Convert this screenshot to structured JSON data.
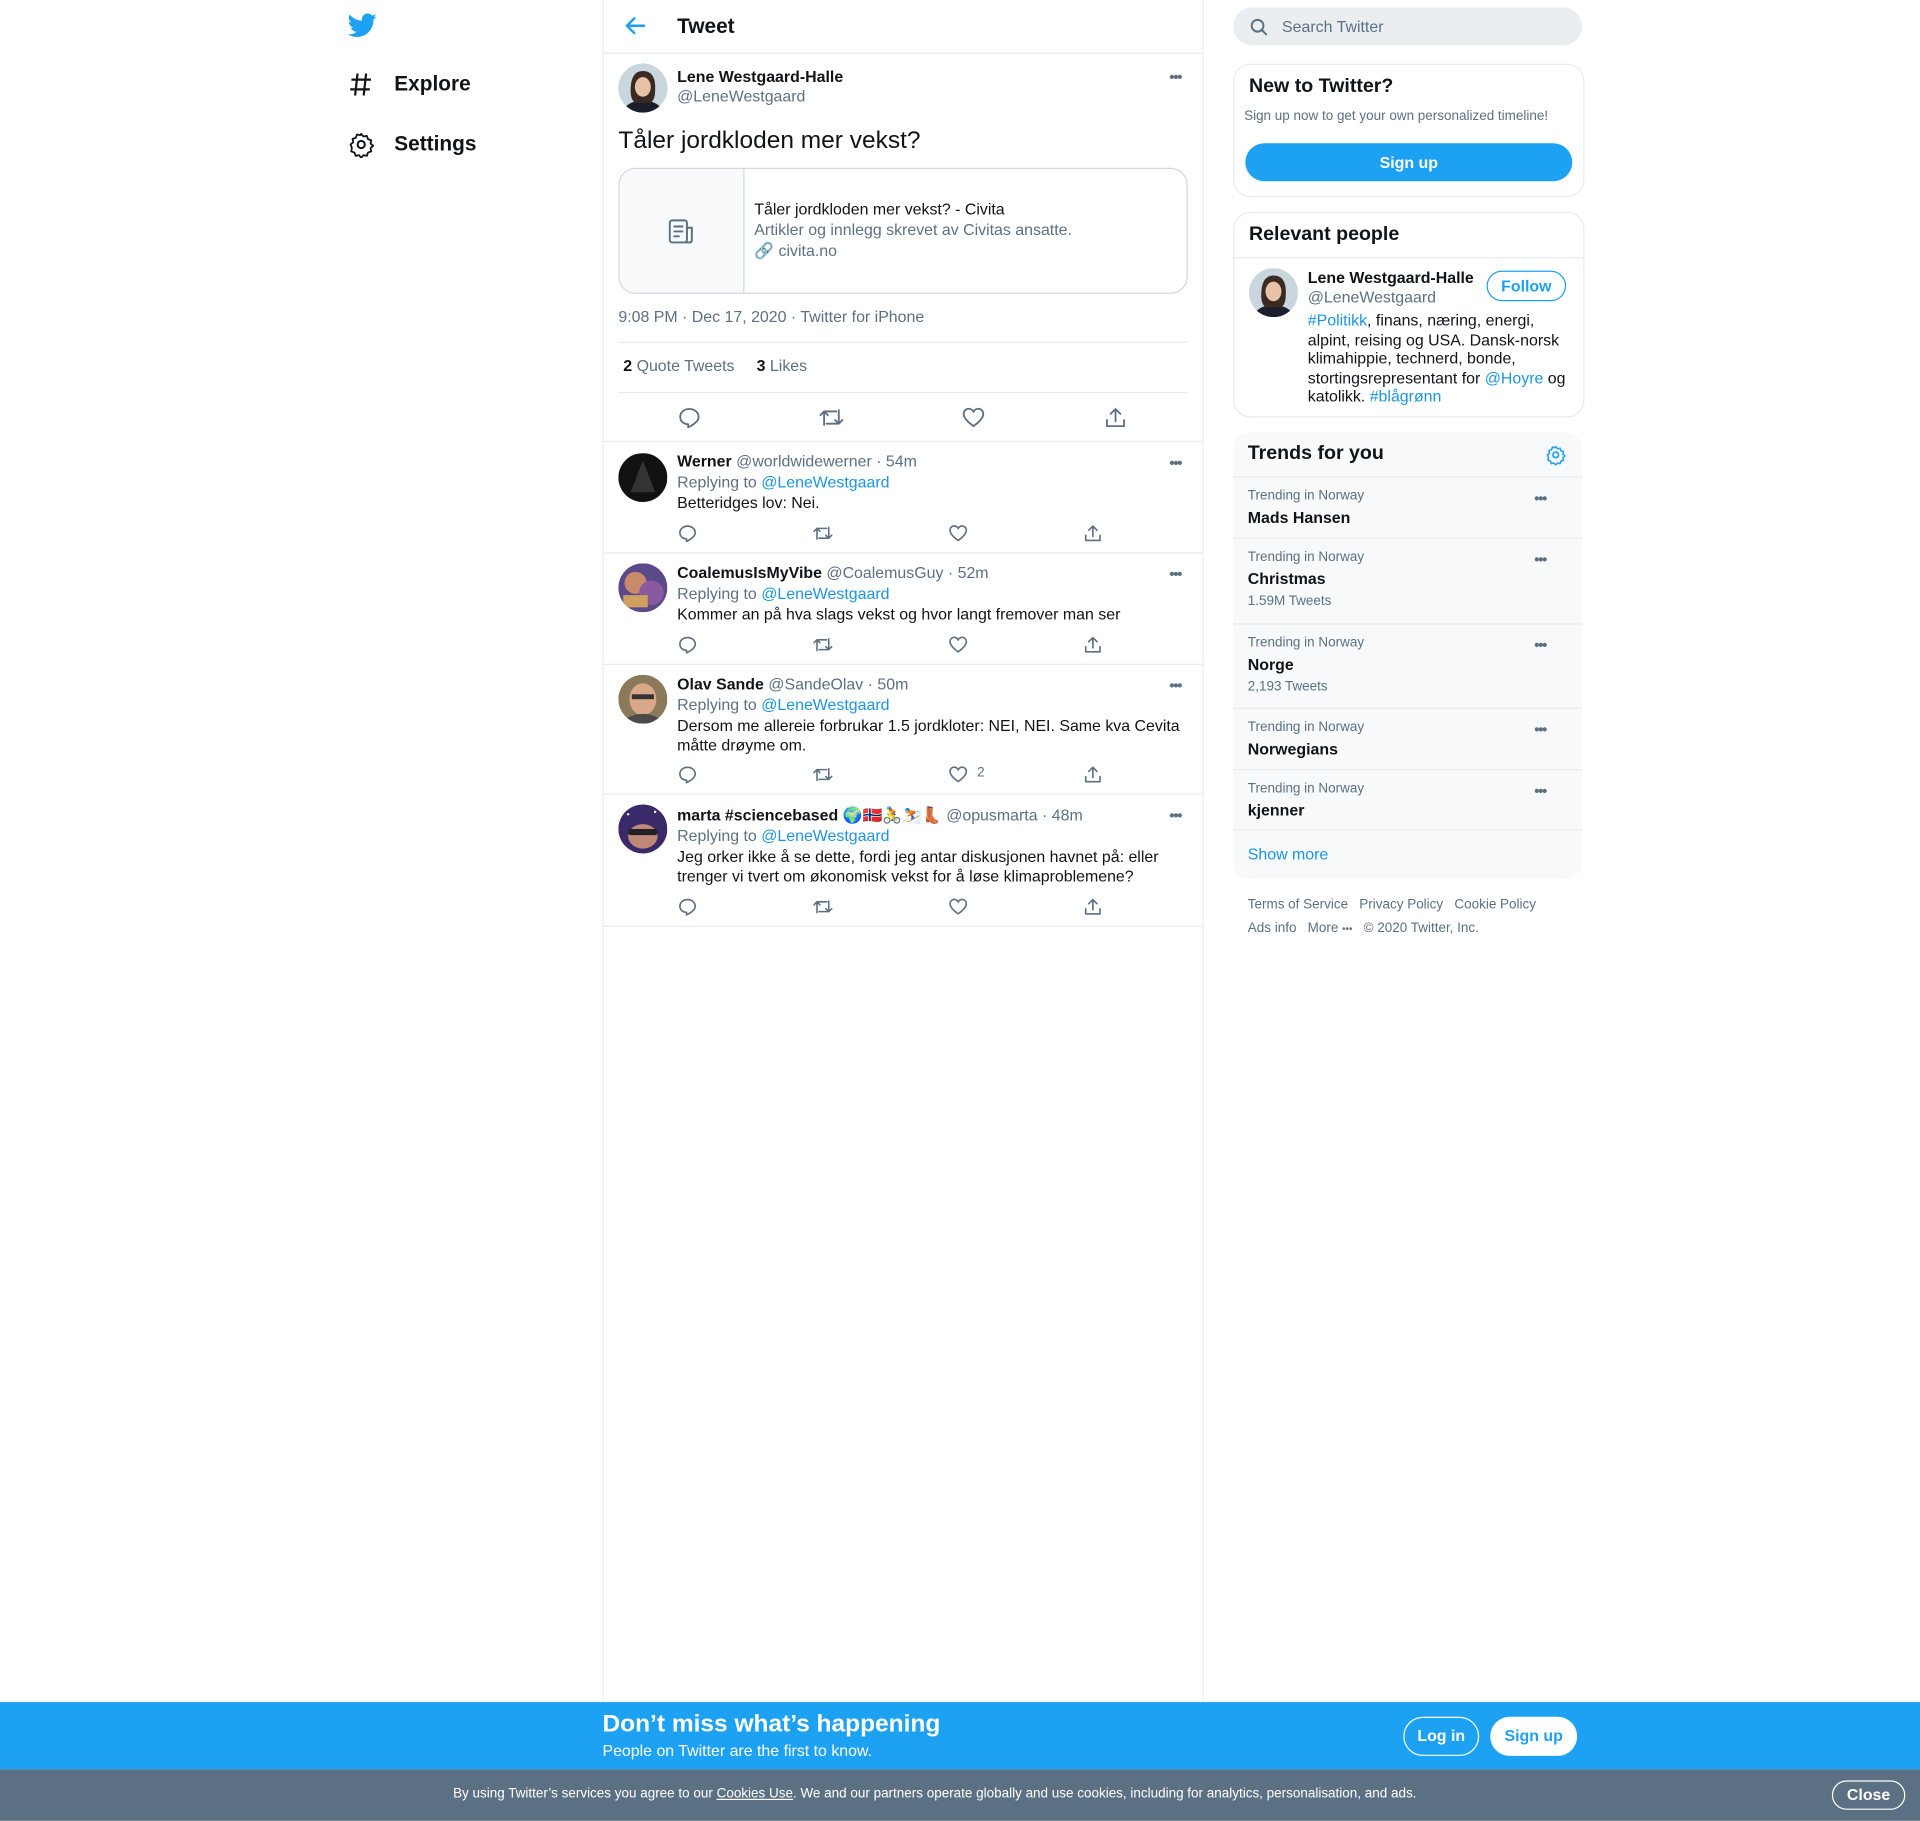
{
  "colors": {
    "accent": "#1da1f2",
    "link": "#1b95e0",
    "secondary_text": "#5b7083",
    "border": "#e6ecf0",
    "cookie_bar": "#5b7083"
  },
  "nav": {
    "logo_icon": "twitter-bird-icon",
    "explore": "Explore",
    "settings": "Settings"
  },
  "header": {
    "title": "Tweet"
  },
  "tweet": {
    "author_name": "Lene Westgaard-Halle",
    "author_handle": "@LeneWestgaard",
    "text": "Tåler jordkloden mer vekst?",
    "card": {
      "title": "Tåler jordkloden mer vekst? - Civita",
      "description": "Artikler og innlegg skrevet av Civitas ansatte.",
      "domain": "civita.no"
    },
    "meta": "9:08 PM · Dec 17, 2020 · Twitter for iPhone",
    "quote_count": "2",
    "quote_label": "Quote Tweets",
    "like_count": "3",
    "like_label": "Likes"
  },
  "replies": [
    {
      "name": "Werner",
      "handle": "@worldwidewerner",
      "time": "· 54m",
      "replying_label": "Replying to",
      "replying_to": "@LeneWestgaard",
      "text": "Betteridges lov: Nei.",
      "likes": ""
    },
    {
      "name": "CoalemusIsMyVibe",
      "handle": "@CoalemusGuy",
      "time": "· 52m",
      "replying_label": "Replying to",
      "replying_to": "@LeneWestgaard",
      "text": "Kommer an på hva slags vekst og hvor langt fremover man ser",
      "likes": ""
    },
    {
      "name": "Olav Sande",
      "handle": "@SandeOlav",
      "time": "· 50m",
      "replying_label": "Replying to",
      "replying_to": "@LeneWestgaard",
      "text": "Dersom me allereie forbrukar 1.5 jordkloter: NEI, NEI. Same kva Cevita måtte drøyme om.",
      "likes": "2"
    },
    {
      "name": "marta #sciencebased",
      "emoji": "🌍🇳🇴🚴⛷️👢",
      "handle": "@opusmarta",
      "time": "· 48m",
      "replying_label": "Replying to",
      "replying_to": "@LeneWestgaard",
      "text": "Jeg orker ikke å se dette, fordi jeg antar diskusjonen havnet på: eller trenger vi tvert om økonomisk vekst for å løse klimaproblemene?",
      "likes": ""
    }
  ],
  "search": {
    "placeholder": "Search Twitter"
  },
  "new_to_twitter": {
    "title": "New to Twitter?",
    "subtitle": "Sign up now to get your own personalized timeline!",
    "button": "Sign up"
  },
  "relevant_people": {
    "title": "Relevant people",
    "name": "Lene Westgaard-Halle",
    "handle": "@LeneWestgaard",
    "follow": "Follow",
    "bio": {
      "tag1": "#Politikk",
      "part1": ", finans, næring, energi, alpint, reising og USA. Dansk-norsk klimahippie, technerd, bonde, stortingsrepresentant for ",
      "mention": "@Hoyre",
      "part2": " og katolikk. ",
      "tag2": "#blågrønn"
    }
  },
  "trends": {
    "title": "Trends for you",
    "items": [
      {
        "context": "Trending in Norway",
        "name": "Mads Hansen",
        "count": ""
      },
      {
        "context": "Trending in Norway",
        "name": "Christmas",
        "count": "1.59M Tweets"
      },
      {
        "context": "Trending in Norway",
        "name": "Norge",
        "count": "2,193 Tweets"
      },
      {
        "context": "Trending in Norway",
        "name": "Norwegians",
        "count": ""
      },
      {
        "context": "Trending in Norway",
        "name": "kjenner",
        "count": ""
      }
    ],
    "show_more": "Show more"
  },
  "footer": {
    "terms": "Terms of Service",
    "privacy": "Privacy Policy",
    "cookie": "Cookie Policy",
    "ads": "Ads info",
    "more": "More",
    "copyright": "© 2020 Twitter, Inc."
  },
  "banner": {
    "heading": "Don’t miss what’s happening",
    "sub": "People on Twitter are the first to know.",
    "login": "Log in",
    "signup": "Sign up"
  },
  "cookie_bar": {
    "text_before": "By using Twitter’s services you agree to our ",
    "link": "Cookies Use",
    "text_after": ". We and our partners operate globally and use cookies, including for analytics, personalisation, and ads.",
    "close": "Close"
  }
}
